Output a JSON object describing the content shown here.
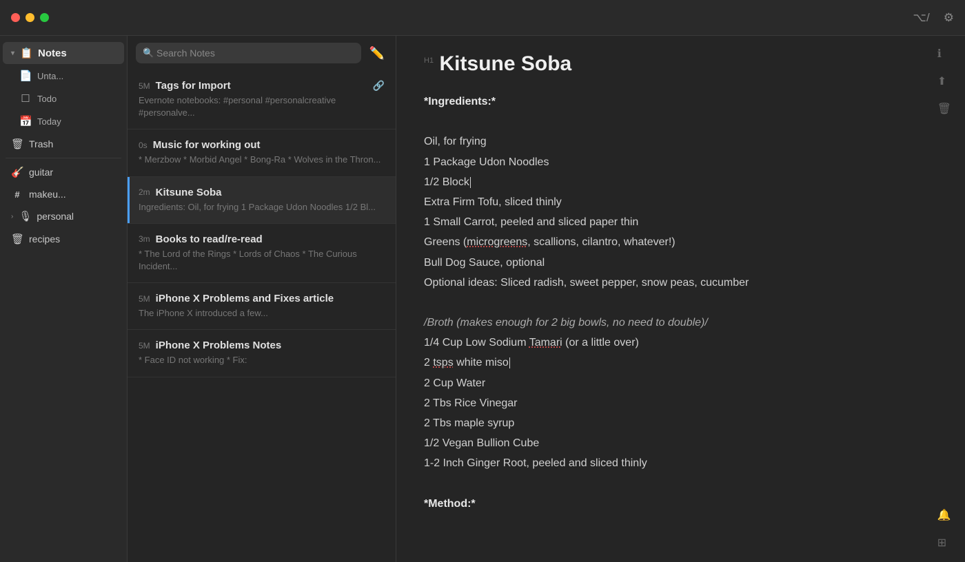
{
  "titlebar": {
    "icons": {
      "code": "⌥",
      "sliders": "⚙"
    }
  },
  "sidebar": {
    "notes_label": "Notes",
    "items": [
      {
        "id": "notes",
        "label": "Notes",
        "icon": "📋",
        "type": "header"
      },
      {
        "id": "untitled",
        "label": "Unta...",
        "icon": "📄",
        "type": "sub"
      },
      {
        "id": "todo",
        "label": "Todo",
        "icon": "☐",
        "type": "sub"
      },
      {
        "id": "today",
        "label": "Today",
        "icon": "📅",
        "type": "sub"
      },
      {
        "id": "trash",
        "label": "Trash",
        "icon": "🗑",
        "type": "item"
      },
      {
        "id": "guitar",
        "label": "guitar",
        "icon": "🎸",
        "type": "item"
      },
      {
        "id": "makeup",
        "label": "makeu...",
        "icon": "#",
        "type": "item"
      },
      {
        "id": "personal",
        "label": "personal",
        "icon": "🎙",
        "type": "item",
        "has_chevron": true
      },
      {
        "id": "recipes",
        "label": "recipes",
        "icon": "🗑",
        "type": "item"
      }
    ]
  },
  "notes_list": {
    "search_placeholder": "Search Notes",
    "items": [
      {
        "id": "tags",
        "time": "5M",
        "title": "Tags for Import",
        "preview": "Evernote notebooks: #personal #personalcreative #personalve...",
        "has_icon": true,
        "active": false
      },
      {
        "id": "music",
        "time": "0s",
        "title": "Music for working out",
        "preview": "* Merzbow * Morbid Angel * Bong-Ra * Wolves in the Thron...",
        "has_icon": false,
        "active": false
      },
      {
        "id": "kitsune",
        "time": "2m",
        "title": "Kitsune Soba",
        "preview": "Ingredients: Oil, for frying 1 Package Udon Noodles 1/2 Bl...",
        "has_icon": false,
        "active": true
      },
      {
        "id": "books",
        "time": "3m",
        "title": "Books to read/re-read",
        "preview": "* The Lord of the Rings * Lords of Chaos * The Curious Incident...",
        "has_icon": false,
        "active": false
      },
      {
        "id": "iphonex-fixes",
        "time": "5M",
        "title": "iPhone X Problems and Fixes article",
        "preview": "The iPhone X introduced a few...",
        "has_icon": false,
        "active": false
      },
      {
        "id": "iphonex-notes",
        "time": "5M",
        "title": "iPhone X Problems Notes",
        "preview": "* Face ID not working * Fix:",
        "has_icon": false,
        "active": false
      }
    ]
  },
  "note": {
    "heading_label": "H1",
    "title": "Kitsune Soba",
    "content": {
      "ingredients_label": "*Ingredients:*",
      "lines": [
        {
          "text": "Oil, for frying",
          "type": "normal"
        },
        {
          "text": "1 Package Udon Noodles",
          "type": "normal"
        },
        {
          "text": "1/2 Block",
          "type": "cursor",
          "cursor": true
        },
        {
          "text": "Extra Firm Tofu, sliced thinly",
          "type": "normal"
        },
        {
          "text": "1 Small Carrot, peeled and sliced paper thin",
          "type": "normal"
        },
        {
          "text": "Greens (microgreens, scallions, cilantro, whatever!)",
          "type": "underline_micro"
        },
        {
          "text": "Bull Dog Sauce, optional",
          "type": "normal"
        },
        {
          "text": "Optional ideas: Sliced radish, sweet pepper, snow peas, cucumber",
          "type": "normal"
        }
      ],
      "broth_header": "/Broth (makes enough for 2 big bowls, no need to double)/",
      "broth_lines": [
        {
          "text": "1/4 Cup Low Sodium Tamari (or a little over)",
          "type": "underline_tamari"
        },
        {
          "text": "2 tsps white miso",
          "type": "underline_tsps",
          "cursor": true
        },
        {
          "text": "2 Cup Water",
          "type": "normal"
        },
        {
          "text": "2 Tbs Rice Vinegar",
          "type": "normal"
        },
        {
          "text": "2 Tbs maple syrup",
          "type": "normal"
        },
        {
          "text": "1/2 Vegan Bullion Cube",
          "type": "normal"
        },
        {
          "text": "1-2 Inch Ginger Root, peeled and sliced thinly",
          "type": "normal"
        }
      ],
      "method_label": "*Method:*"
    }
  }
}
